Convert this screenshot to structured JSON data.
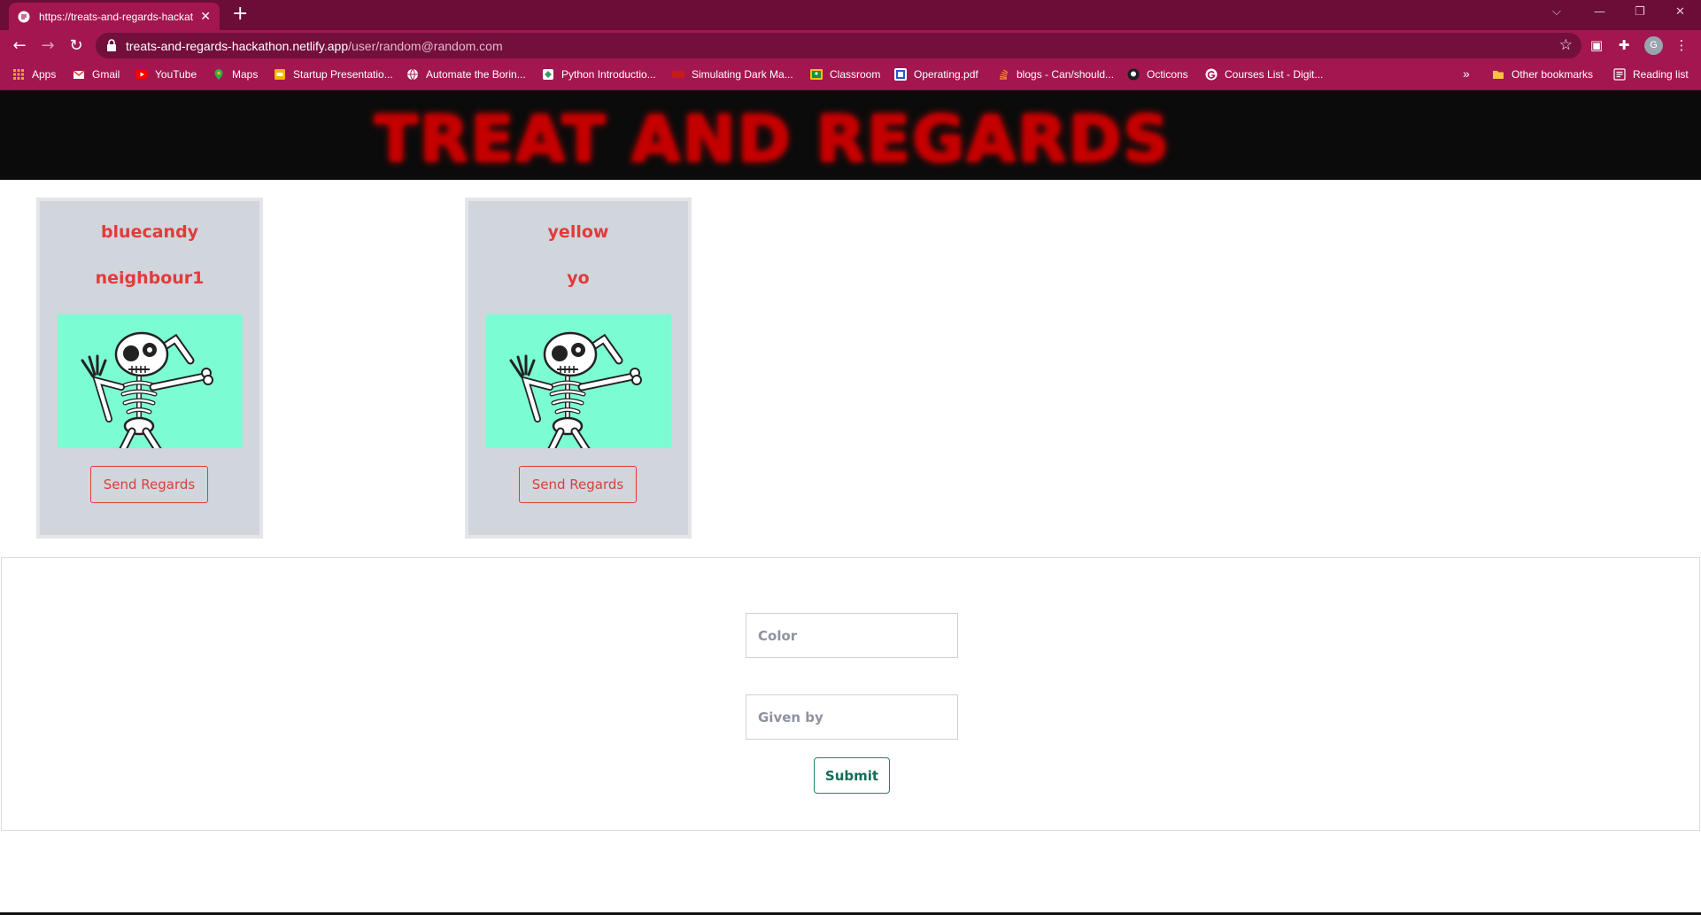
{
  "browser": {
    "tab_title": "https://treats-and-regards-hackathon.netlify.app/user/random@random.com",
    "tab_close": "✕",
    "new_tab": "+",
    "controls": {
      "tabsearch": "⌵",
      "minimize": "—",
      "restore": "❐",
      "close": "✕"
    },
    "url_host": "treats-and-regards-hackathon.netlify.app",
    "url_path": "/user/random@random.com",
    "avatar_letter": "G",
    "bookmarks": [
      {
        "label": "Apps",
        "icon": "apps-grid-icon",
        "color": "#e8a33a"
      },
      {
        "label": "Gmail",
        "icon": "gmail-icon",
        "color": "#ea4335"
      },
      {
        "label": "YouTube",
        "icon": "youtube-icon",
        "color": "#ff0000"
      },
      {
        "label": "Maps",
        "icon": "maps-pin-icon",
        "color": "#34a853"
      },
      {
        "label": "Startup Presentatio...",
        "icon": "slides-icon",
        "color": "#f4b400"
      },
      {
        "label": "Automate the Borin...",
        "icon": "globe-icon",
        "color": "#ffffff"
      },
      {
        "label": "Python Introductio...",
        "icon": "python-icon",
        "color": "#3c9a5f"
      },
      {
        "label": "Simulating Dark Ma...",
        "icon": "page-icon",
        "color": "#c61b1b"
      },
      {
        "label": "Classroom",
        "icon": "classroom-icon",
        "color": "#1e8e3e"
      },
      {
        "label": "Operating.pdf",
        "icon": "pdf-icon",
        "color": "#2b56c8"
      },
      {
        "label": "blogs - Can/should...",
        "icon": "stack-icon",
        "color": "#f48024"
      },
      {
        "label": "Octicons",
        "icon": "github-icon",
        "color": "#1b1f24"
      },
      {
        "label": "Courses List - Digit...",
        "icon": "google-icon",
        "color": "#ffffff"
      }
    ],
    "more_bookmarks": "»",
    "other_bookmarks": "Other bookmarks",
    "reading_list": "Reading list"
  },
  "site": {
    "title": "TREAT AND REGARDS"
  },
  "cards": [
    {
      "color": "bluecandy",
      "giver": "neighbour1",
      "button": "Send Regards"
    },
    {
      "color": "yellow",
      "giver": "yo",
      "button": "Send Regards"
    }
  ],
  "form": {
    "color_placeholder": "Color",
    "given_by_placeholder": "Given by",
    "submit_label": "Submit"
  }
}
